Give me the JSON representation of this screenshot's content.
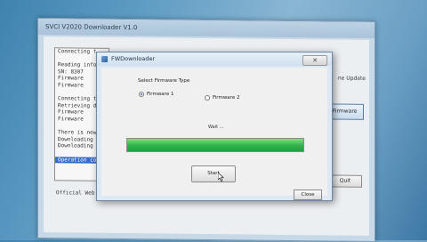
{
  "background_window": {
    "title": "SVCI V2020 Downloader V1.0",
    "log_lines": [
      "Connecting t",
      "",
      "Reading info",
      "   SN: 8307",
      "   Firmware",
      "   Firmware",
      "",
      "Connecting t",
      "Retrieving d",
      "   Firmware",
      "   Firmware",
      "",
      "There is new",
      "Downloading",
      "Downloading",
      "",
      "Operation co"
    ],
    "selected_log_index": 16,
    "update_text": "ne Update",
    "firmware_button_label": "le Firmware",
    "quit_button_label": "Quit",
    "footer_text": "Official Web"
  },
  "dialog": {
    "title": "FWDownloader",
    "firmware_type_label": "Select Firmware Type",
    "radio_options": [
      {
        "label": "Firmware 1",
        "checked": true
      },
      {
        "label": "Firmware 2",
        "checked": false
      }
    ],
    "status_text": "Wait ...",
    "progress_fraction": 1.0,
    "start_button_label": "Start",
    "close_button_label": "Close",
    "close_icon_glyph": "✕"
  },
  "colors": {
    "progress_green": "#2fb14a",
    "selection_blue": "#3b6bc8",
    "desktop_blue": "#5c9ac2"
  }
}
